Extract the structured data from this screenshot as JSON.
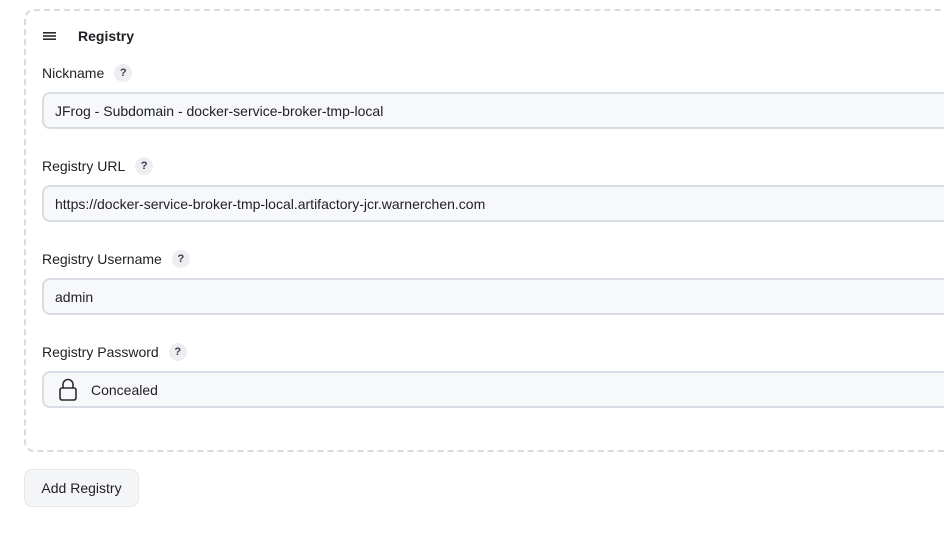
{
  "section": {
    "title": "Registry",
    "drag_icon": "hamburger-icon"
  },
  "fields": {
    "nickname": {
      "label": "Nickname",
      "help": "?",
      "value": "JFrog - Subdomain - docker-service-broker-tmp-local"
    },
    "url": {
      "label": "Registry URL",
      "help": "?",
      "value": "https://docker-service-broker-tmp-local.artifactory-jcr.warnerchen.com"
    },
    "username": {
      "label": "Registry Username",
      "help": "?",
      "value": "admin"
    },
    "password": {
      "label": "Registry Password",
      "help": "?",
      "value": "Concealed",
      "icon": "lock-icon"
    }
  },
  "actions": {
    "add_label": "Add Registry"
  }
}
